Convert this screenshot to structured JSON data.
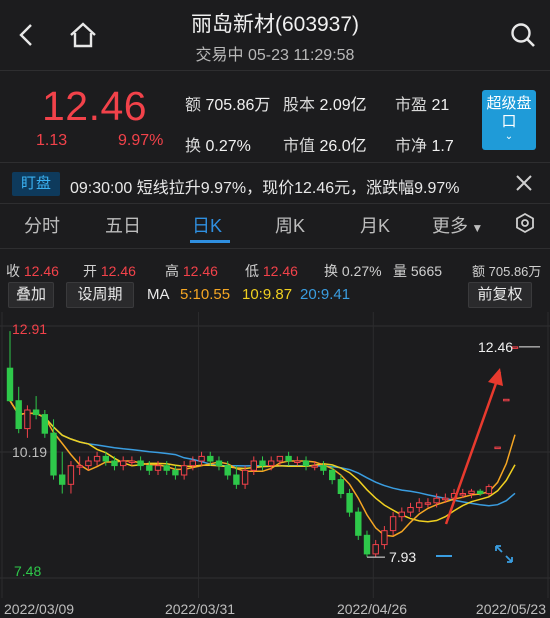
{
  "header": {
    "title": "丽岛新材(603937)",
    "subtitle": "交易中 05-23 11:29:58"
  },
  "quote": {
    "price": "12.46",
    "change": "1.13",
    "change_pct": "9.97%",
    "amount_label": "额",
    "amount": "705.86万",
    "share_label": "股本",
    "share": "2.09亿",
    "pe_label": "市盈",
    "pe": "21",
    "turnover_label": "换",
    "turnover": "0.27%",
    "mktcap_label": "市值",
    "mktcap": "26.0亿",
    "pb_label": "市净",
    "pb": "1.7",
    "super_btn": "超级盘口"
  },
  "alert": {
    "tag": "盯盘",
    "text": "09:30:00 短线拉升9.97%，现价12.46元，涨跌幅9.97%"
  },
  "tabs": [
    "分时",
    "五日",
    "日K",
    "周K",
    "月K",
    "更多"
  ],
  "active_tab": "日K",
  "info": {
    "close_label": "收",
    "close": "12.46",
    "open_label": "开",
    "open": "12.46",
    "high_label": "高",
    "high": "12.46",
    "low_label": "低",
    "low": "12.46",
    "turn_label": "换",
    "turn": "0.27%",
    "vol_label": "量",
    "vol": "5665",
    "amt_label": "额",
    "amt": "705.86万"
  },
  "toolbar": {
    "overlay": "叠加",
    "period": "设周期",
    "ma_label": "MA",
    "ma5": "5:10.55",
    "ma10": "10:9.87",
    "ma20": "20:9.41",
    "adjust": "前复权"
  },
  "colors": {
    "up": "#f2424a",
    "down": "#2ec84a",
    "ma5": "#f5a623",
    "ma10": "#f0d020",
    "ma20": "#3a9de0",
    "accent": "#2f8fe0"
  },
  "chart_data": {
    "type": "candlestick",
    "y_top_label": "12.91",
    "y_mid_label": "10.19",
    "y_bottom_label": "7.48",
    "ylim": [
      7.48,
      12.91
    ],
    "x_labels": [
      "2022/03/09",
      "2022/03/31",
      "2022/04/26",
      "2022/05/23"
    ],
    "high_marker": "12.46",
    "low_marker": "7.93",
    "candles": [
      [
        12.0,
        12.8,
        11.3,
        11.3
      ],
      [
        11.3,
        11.6,
        10.6,
        10.7
      ],
      [
        10.7,
        11.2,
        10.5,
        11.1
      ],
      [
        11.1,
        11.4,
        10.9,
        11.0
      ],
      [
        11.0,
        11.1,
        10.5,
        10.6
      ],
      [
        10.6,
        10.9,
        9.6,
        9.7
      ],
      [
        9.7,
        10.2,
        9.3,
        9.5
      ],
      [
        9.5,
        10.0,
        9.3,
        9.9
      ],
      [
        9.9,
        10.1,
        9.7,
        9.9
      ],
      [
        9.9,
        10.1,
        9.8,
        10.0
      ],
      [
        10.0,
        10.2,
        9.9,
        10.1
      ],
      [
        10.1,
        10.2,
        9.9,
        10.0
      ],
      [
        10.0,
        10.1,
        9.8,
        9.9
      ],
      [
        9.9,
        10.1,
        9.8,
        10.0
      ],
      [
        10.0,
        10.1,
        9.9,
        10.0
      ],
      [
        10.0,
        10.1,
        9.8,
        9.9
      ],
      [
        9.9,
        10.0,
        9.7,
        9.8
      ],
      [
        9.8,
        10.0,
        9.7,
        9.9
      ],
      [
        9.9,
        10.0,
        9.7,
        9.8
      ],
      [
        9.8,
        9.9,
        9.6,
        9.7
      ],
      [
        9.7,
        10.0,
        9.6,
        9.9
      ],
      [
        9.9,
        10.1,
        9.8,
        10.0
      ],
      [
        10.0,
        10.2,
        9.9,
        10.1
      ],
      [
        10.1,
        10.2,
        9.9,
        10.0
      ],
      [
        10.0,
        10.1,
        9.8,
        9.9
      ],
      [
        9.9,
        10.0,
        9.6,
        9.7
      ],
      [
        9.7,
        9.9,
        9.4,
        9.5
      ],
      [
        9.5,
        9.9,
        9.4,
        9.8
      ],
      [
        9.8,
        10.1,
        9.7,
        10.0
      ],
      [
        10.0,
        10.1,
        9.8,
        9.9
      ],
      [
        9.9,
        10.1,
        9.8,
        10.0
      ],
      [
        10.0,
        10.1,
        9.9,
        10.1
      ],
      [
        10.1,
        10.2,
        9.9,
        10.0
      ],
      [
        10.0,
        10.1,
        9.9,
        10.0
      ],
      [
        10.0,
        10.1,
        9.8,
        9.9
      ],
      [
        9.9,
        10.0,
        9.8,
        9.9
      ],
      [
        9.9,
        10.0,
        9.7,
        9.8
      ],
      [
        9.8,
        9.9,
        9.5,
        9.6
      ],
      [
        9.6,
        9.7,
        9.2,
        9.3
      ],
      [
        9.3,
        9.4,
        8.8,
        8.9
      ],
      [
        8.9,
        9.0,
        8.3,
        8.4
      ],
      [
        8.4,
        8.5,
        7.93,
        8.0
      ],
      [
        8.0,
        8.3,
        7.93,
        8.2
      ],
      [
        8.2,
        8.6,
        8.1,
        8.5
      ],
      [
        8.5,
        8.9,
        8.4,
        8.8
      ],
      [
        8.8,
        9.0,
        8.7,
        8.9
      ],
      [
        8.9,
        9.1,
        8.8,
        9.0
      ],
      [
        9.0,
        9.2,
        8.9,
        9.1
      ],
      [
        9.1,
        9.2,
        9.0,
        9.1
      ],
      [
        9.1,
        9.3,
        9.0,
        9.2
      ],
      [
        9.2,
        9.3,
        9.1,
        9.2
      ],
      [
        9.2,
        9.4,
        9.1,
        9.3
      ],
      [
        9.3,
        9.4,
        9.2,
        9.3
      ],
      [
        9.3,
        9.4,
        9.2,
        9.35
      ],
      [
        9.35,
        9.4,
        9.25,
        9.3
      ],
      [
        9.3,
        9.5,
        9.25,
        9.45
      ],
      [
        10.3,
        10.3,
        10.3,
        10.3
      ],
      [
        11.33,
        11.33,
        11.33,
        11.33
      ],
      [
        12.46,
        12.46,
        12.46,
        12.46
      ]
    ]
  }
}
